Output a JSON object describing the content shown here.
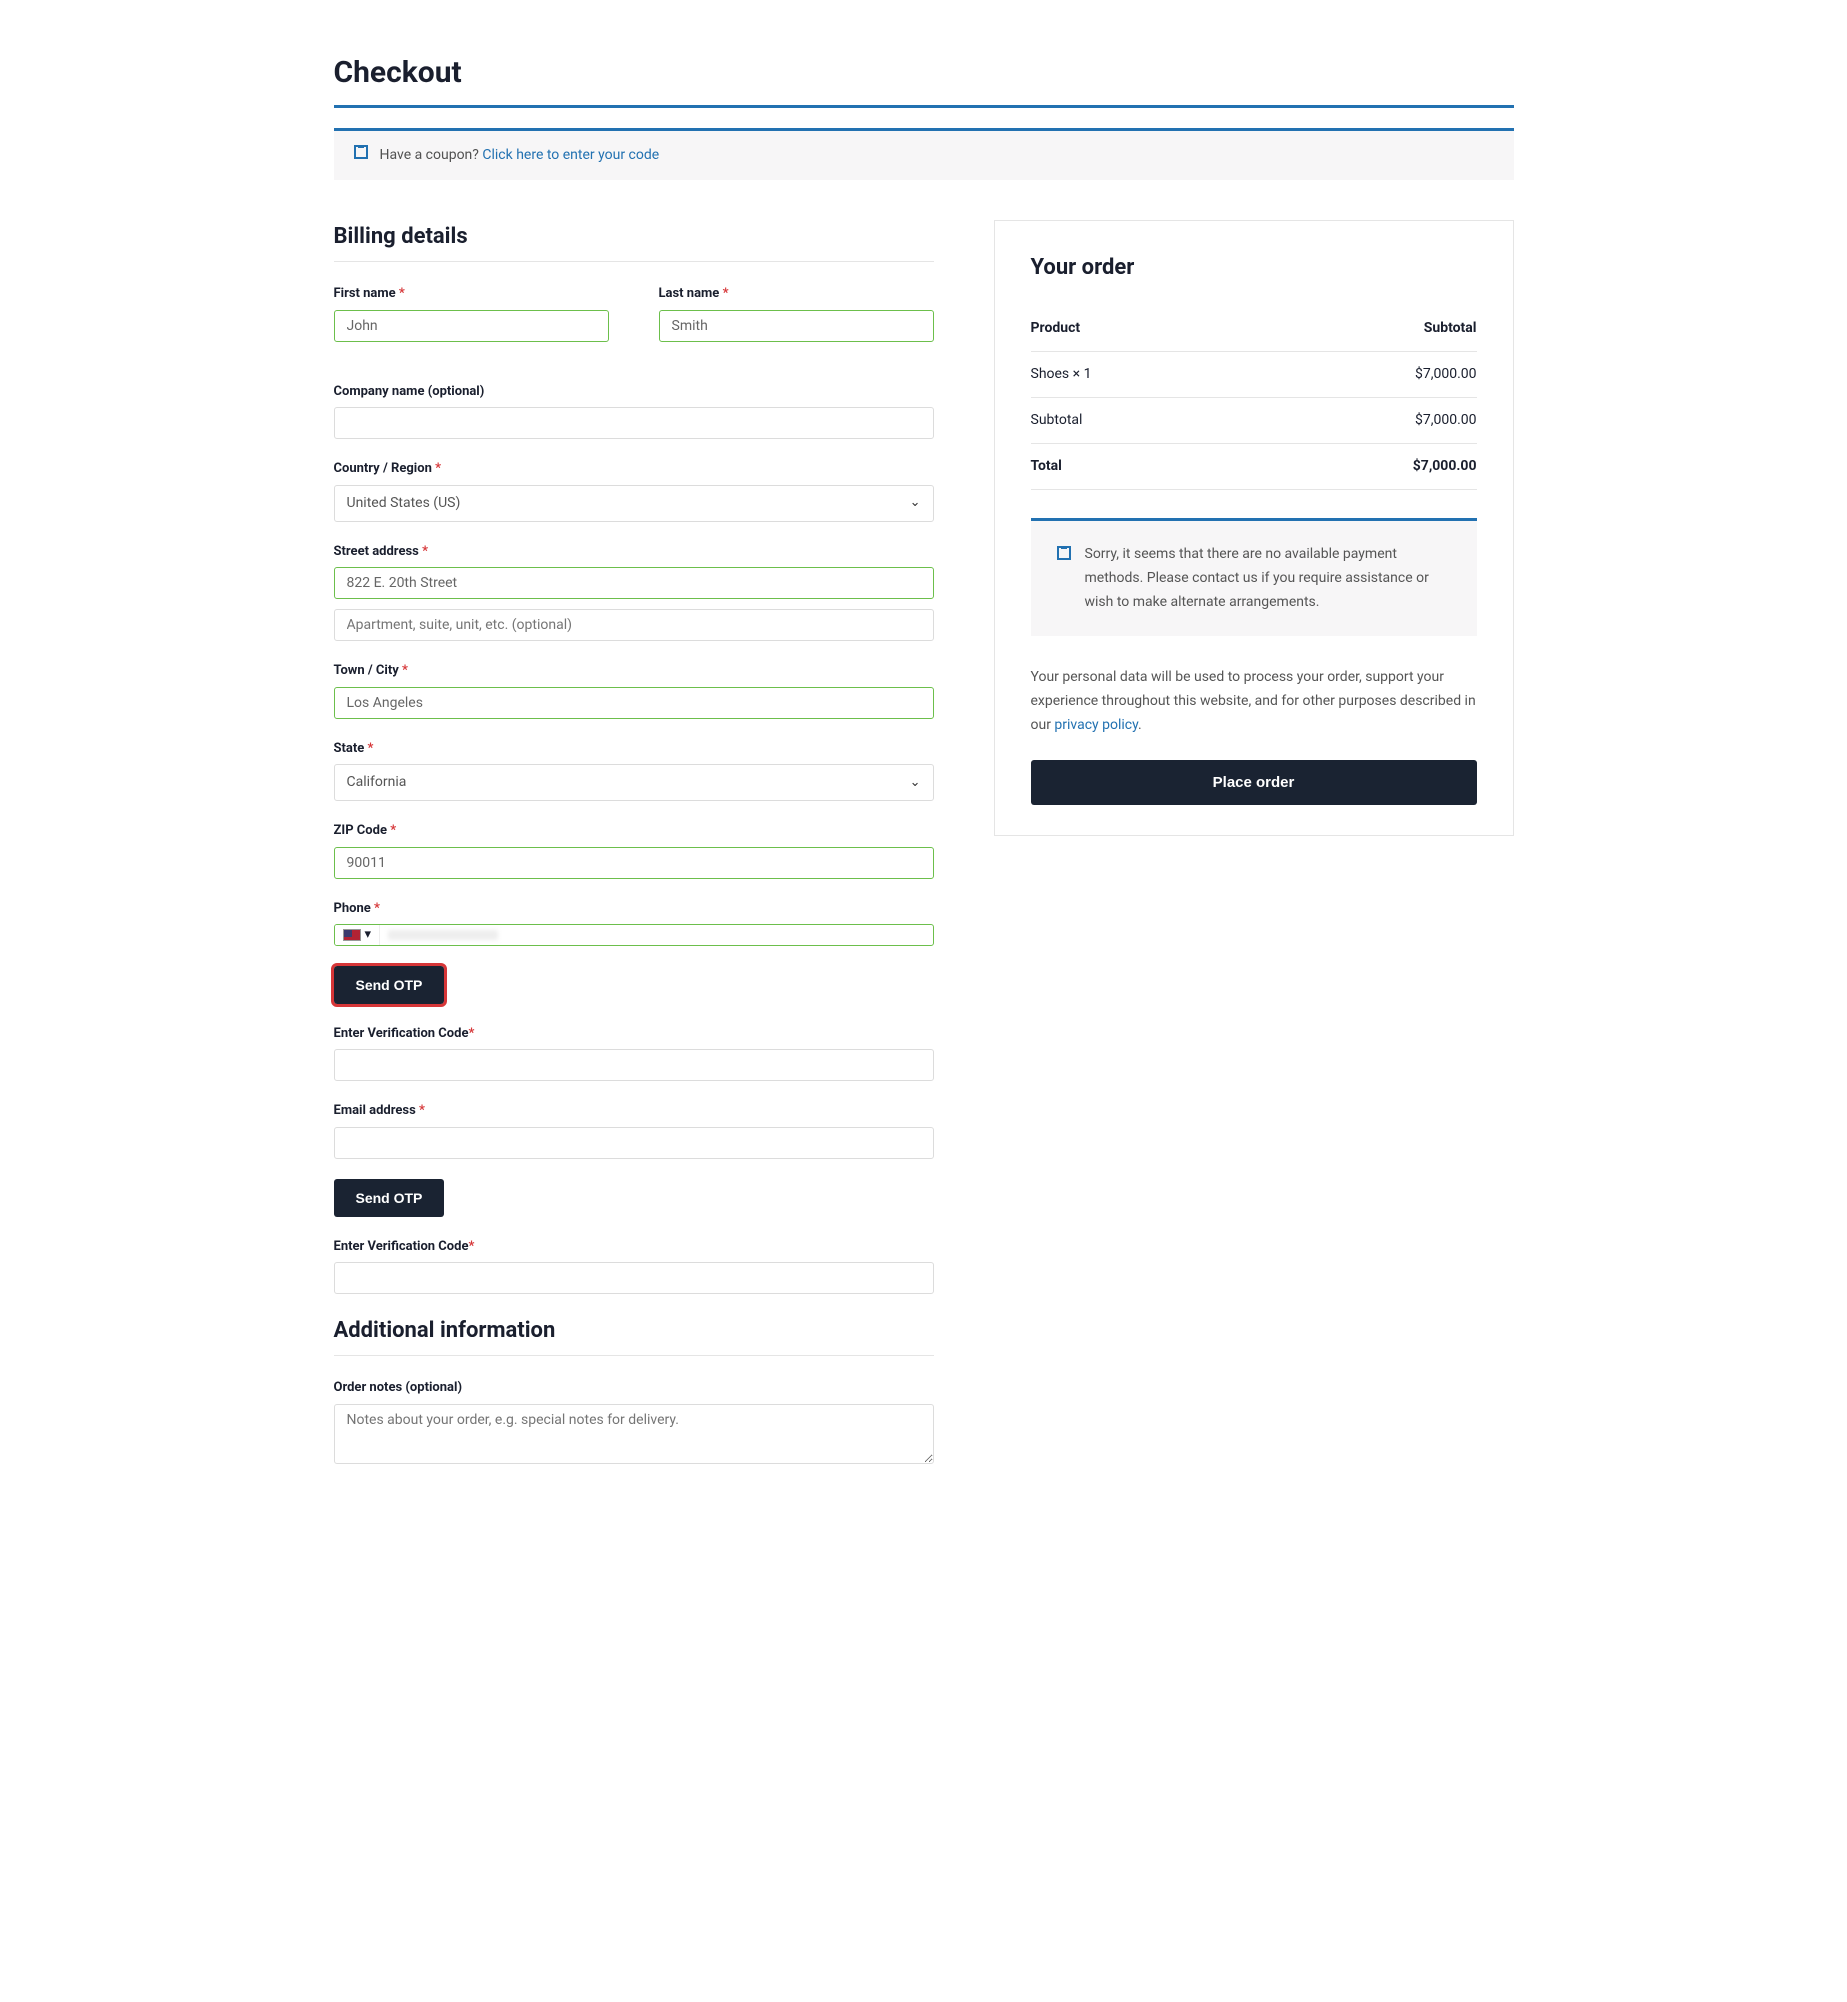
{
  "page": {
    "title": "Checkout"
  },
  "coupon": {
    "prefix": "Have a coupon? ",
    "link": "Click here to enter your code"
  },
  "billing": {
    "heading": "Billing details",
    "first_name_label": "First name",
    "first_name_value": "John",
    "last_name_label": "Last name",
    "last_name_value": "Smith",
    "company_label": "Company name (optional)",
    "company_value": "",
    "country_label": "Country / Region",
    "country_value": "United States (US)",
    "street_label": "Street address",
    "street1_value": "822 E. 20th Street",
    "street2_placeholder": "Apartment, suite, unit, etc. (optional)",
    "city_label": "Town / City",
    "city_value": "Los Angeles",
    "state_label": "State",
    "state_value": "California",
    "zip_label": "ZIP Code",
    "zip_value": "90011",
    "phone_label": "Phone",
    "phone_flag_caret": "▾",
    "send_otp_label": "Send OTP",
    "verify_label": "Enter Verification Code",
    "email_label": "Email address",
    "email_value": "",
    "send_otp2_label": "Send OTP",
    "verify2_label": "Enter Verification Code"
  },
  "additional": {
    "heading": "Additional information",
    "notes_label": "Order notes (optional)",
    "notes_placeholder": "Notes about your order, e.g. special notes for delivery."
  },
  "order": {
    "heading": "Your order",
    "col_product": "Product",
    "col_subtotal": "Subtotal",
    "line_item_name": "Shoes  × 1",
    "line_item_price": "$7,000.00",
    "subtotal_label": "Subtotal",
    "subtotal_value": "$7,000.00",
    "total_label": "Total",
    "total_value": "$7,000.00",
    "no_methods_notice": "Sorry, it seems that there are no available payment methods. Please contact us if you require assistance or wish to make alternate arrangements.",
    "privacy_text": "Your personal data will be used to process your order, support your experience throughout this website, and for other purposes described in our ",
    "privacy_link": "privacy policy",
    "privacy_suffix": ".",
    "place_order_label": "Place order"
  }
}
